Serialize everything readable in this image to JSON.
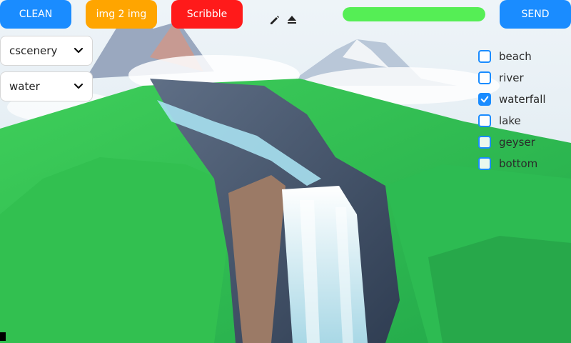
{
  "toolbar": {
    "clean_label": "CLEAN",
    "img2img_label": "img 2 img",
    "scribble_label": "Scribble",
    "send_label": "SEND",
    "pencil_icon": "pencil-icon",
    "eraser_icon": "eraser-icon",
    "progress_fraction": 1.0,
    "progress_color": "#55ee55"
  },
  "selects": {
    "model": {
      "value": "cscenery"
    },
    "subject": {
      "value": "water"
    }
  },
  "checklist": {
    "items": [
      {
        "label": "beach",
        "checked": false
      },
      {
        "label": "river",
        "checked": false
      },
      {
        "label": "waterfall",
        "checked": true
      },
      {
        "label": "lake",
        "checked": false
      },
      {
        "label": "geyser",
        "checked": false
      },
      {
        "label": "bottom",
        "checked": false
      }
    ]
  },
  "colors": {
    "primary": "#1a8cff",
    "img2img": "#ffa500",
    "scribble": "#ff1a1a"
  }
}
